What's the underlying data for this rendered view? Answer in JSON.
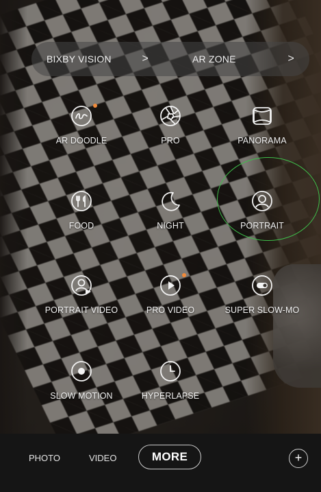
{
  "shortcuts": {
    "bixby_vision": {
      "label": "BIXBY VISION",
      "chevron": ">"
    },
    "ar_zone": {
      "label": "AR ZONE",
      "chevron": ">"
    }
  },
  "modes": {
    "ar_doodle": {
      "label": "AR DOODLE",
      "icon": "ar-doodle-icon",
      "new_badge": true
    },
    "pro": {
      "label": "PRO",
      "icon": "aperture-icon",
      "new_badge": false
    },
    "panorama": {
      "label": "PANORAMA",
      "icon": "panorama-icon",
      "new_badge": false
    },
    "food": {
      "label": "FOOD",
      "icon": "fork-knife-icon",
      "new_badge": false
    },
    "night": {
      "label": "NIGHT",
      "icon": "moon-icon",
      "new_badge": false
    },
    "portrait": {
      "label": "PORTRAIT",
      "icon": "person-icon",
      "new_badge": false
    },
    "portrait_video": {
      "label": "PORTRAIT VIDEO",
      "icon": "portrait-video-icon",
      "new_badge": false
    },
    "pro_video": {
      "label": "PRO VIDEO",
      "icon": "play-icon",
      "new_badge": true
    },
    "super_slow_mo": {
      "label": "SUPER SLOW-MO",
      "icon": "super-slow-mo-icon",
      "new_badge": false
    },
    "slow_motion": {
      "label": "SLOW MOTION",
      "icon": "slow-motion-icon",
      "new_badge": false
    },
    "hyperlapse": {
      "label": "HYPERLAPSE",
      "icon": "clock-icon",
      "new_badge": false
    }
  },
  "bottom_bar": {
    "photo": "PHOTO",
    "video": "VIDEO",
    "more": "MORE",
    "add": "+"
  },
  "colors": {
    "accent_badge": "#f08a3a",
    "highlight_circle": "#3fbf4b",
    "text": "#f3f3f3"
  }
}
